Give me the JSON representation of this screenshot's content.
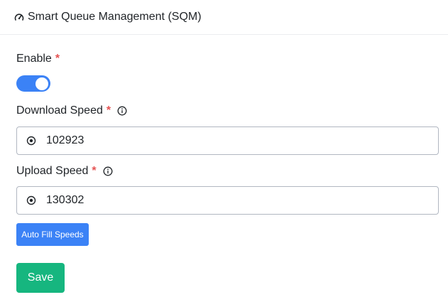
{
  "header": {
    "title": "Smart Queue Management (SQM)",
    "icon": "speedometer-icon"
  },
  "form": {
    "enable": {
      "label": "Enable",
      "required_mark": "*",
      "checked": true,
      "accent_color": "#3b82f6"
    },
    "download_speed": {
      "label": "Download Speed",
      "required_mark": "*",
      "info_icon": "info-icon",
      "input_icon": "radio-dot-icon",
      "value": "102923"
    },
    "upload_speed": {
      "label": "Upload Speed",
      "required_mark": "*",
      "info_icon": "info-icon",
      "input_icon": "radio-dot-icon",
      "value": "130302"
    },
    "autofill_label": "Auto Fill Speeds",
    "save_label": "Save"
  },
  "colors": {
    "primary": "#3b82f6",
    "success": "#16b67f",
    "required": "#e55353"
  }
}
